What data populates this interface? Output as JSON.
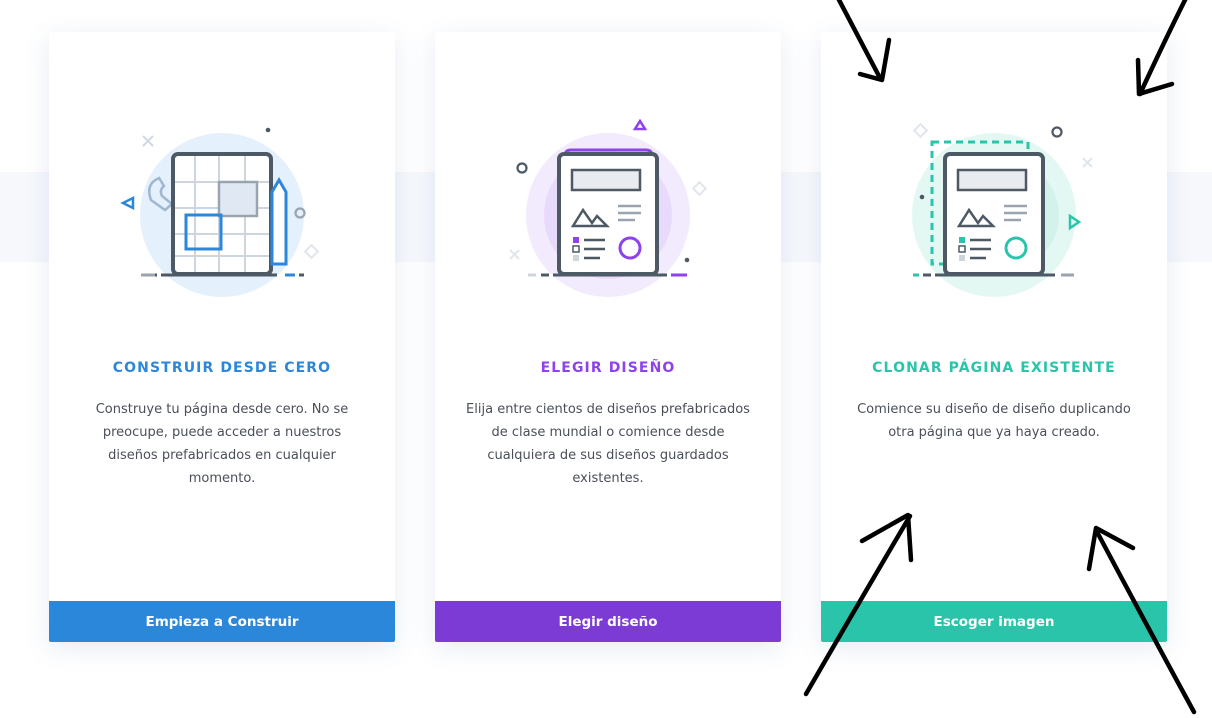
{
  "colors": {
    "build": "#2b87da",
    "layout": "#8f42ec",
    "layout_button": "#7d3bd6",
    "clone": "#29c4a9",
    "ink": "#4a4f5a"
  },
  "cards": [
    {
      "title": "CONSTRUIR DESDE CERO",
      "description": "Construye tu página desde cero. No se preocupe, puede acceder a nuestros diseños prefabricados en cualquier momento.",
      "button": "Empieza a Construir",
      "icon": "blueprint-wireframe-icon"
    },
    {
      "title": "ELEGIR DISEÑO",
      "description": "Elija entre cientos de diseños prefabricados de clase mundial o comience desde cualquiera de sus diseños guardados existentes.",
      "button": "Elegir diseño",
      "icon": "layout-pack-icon"
    },
    {
      "title": "CLONAR PÁGINA EXISTENTE",
      "description": "Comience su diseño de diseño duplicando otra página que ya haya creado.",
      "button": "Escoger imagen",
      "icon": "clone-page-icon"
    }
  ],
  "annotations": {
    "hand_drawn_arrows": 4
  }
}
